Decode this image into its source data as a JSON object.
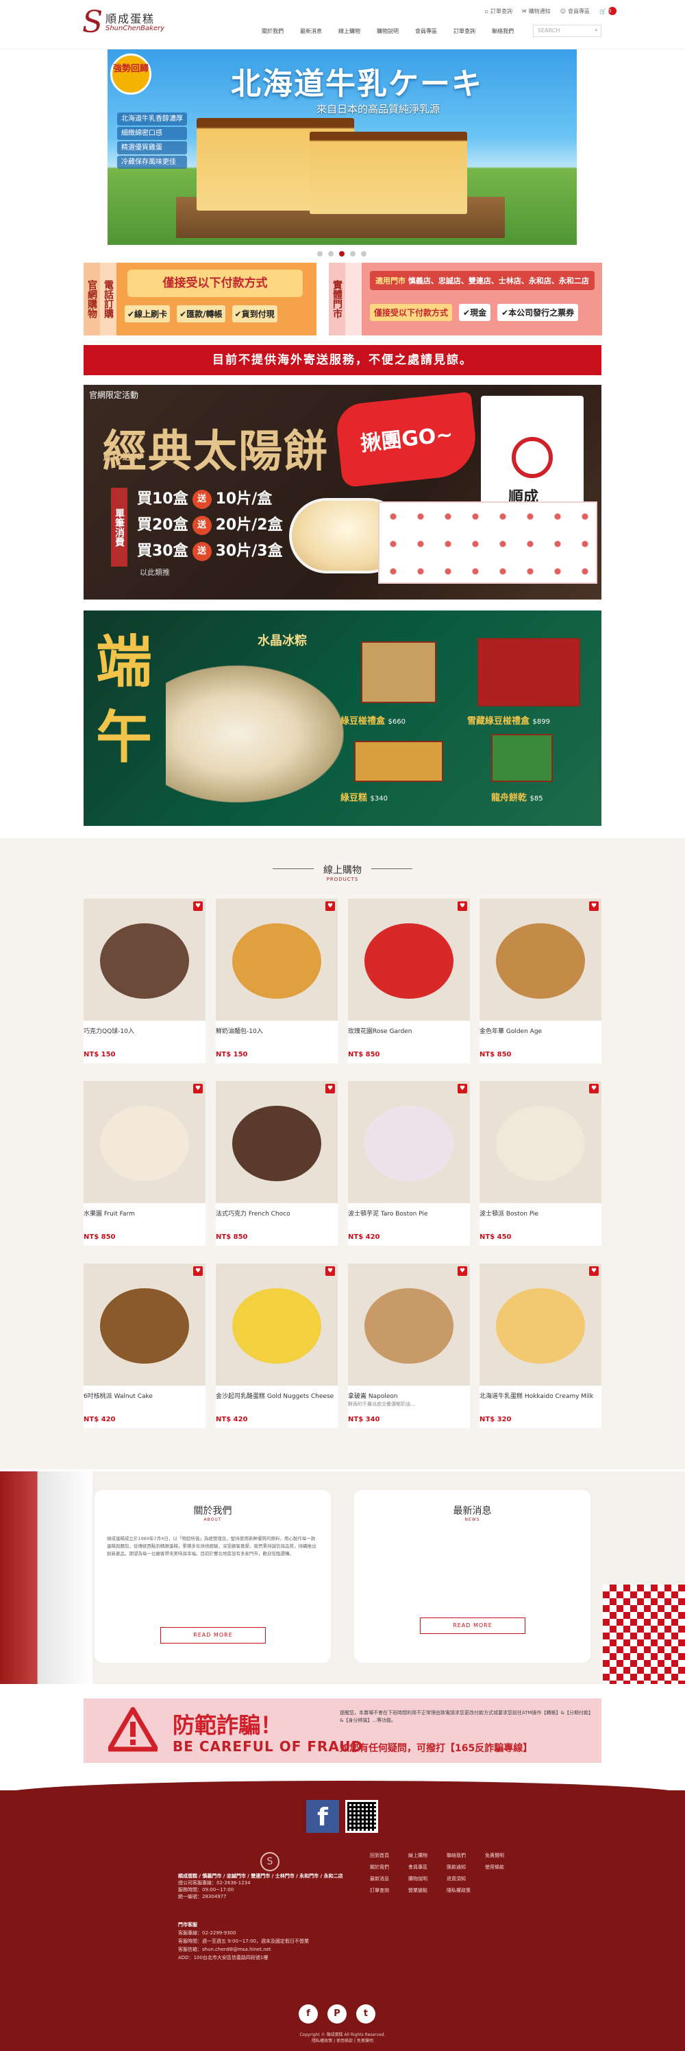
{
  "header": {
    "logo_cn": "順成蛋糕",
    "logo_en": "ShunChenBakery",
    "util": [
      "訂單查詢",
      "購物通知",
      "會員專區"
    ],
    "cart_count": "0",
    "nav": [
      "關於我們",
      "最新消息",
      "線上購物",
      "購物說明",
      "會員專區",
      "訂單查詢",
      "聯絡我們"
    ],
    "search_placeholder": "SEARCH"
  },
  "banner": {
    "badge": "強勢回歸",
    "title": "北海道牛乳ケーキ",
    "subtitle": "來自日本的高品質純淨乳源",
    "points": [
      "北海道牛乳香醇濃厚",
      "細緻綿密口感",
      "精選優質雞蛋",
      "冷藏保存風味更佳"
    ],
    "dots": [
      "1",
      "2",
      "3",
      "4",
      "5"
    ],
    "active_dot": 3
  },
  "order_info": {
    "left_tag": "官網購物",
    "left_tag2": "電話訂購",
    "left_pay": "僅接受以下付款方式",
    "left_methods": [
      "✔線上刷卡",
      "✔匯款/轉帳",
      "✔貨到付現"
    ],
    "right_tag": "實體門市",
    "right_stores_label": "適用門市",
    "right_stores": "慎義店、忠誠店、雙連店、士林店、永和店、永和二店",
    "right_pay": "僅接受以下付款方式",
    "right_methods": [
      "✔現金",
      "✔本公司發行之票券"
    ]
  },
  "notice": "目前不提供海外寄送服務，不便之處請見諒。",
  "promo1": {
    "tag": "官網限定活動",
    "title": "經典太陽餅",
    "buy_offer": "買10送10",
    "side": "單筆消費",
    "deals": [
      {
        "buy": "買10盒",
        "send": "送",
        "get": "10片/盒"
      },
      {
        "buy": "買20盒",
        "send": "送",
        "get": "20片/2盒"
      },
      {
        "buy": "買30盒",
        "send": "送",
        "get": "30片/3盒"
      }
    ],
    "note": "以此類推",
    "burst": "揪團GO~",
    "brand": "順成"
  },
  "promo2": {
    "title": "端午",
    "sub": "水晶冰粽",
    "items": [
      {
        "name": "綠豆椪禮盒",
        "price": "$660"
      },
      {
        "name": "雪藏綠豆椪禮盒",
        "price": "$899"
      },
      {
        "name": "綠豆糕",
        "price": "$340"
      },
      {
        "name": "龍舟餅乾",
        "price": "$85"
      }
    ]
  },
  "shop": {
    "title": "線上購物",
    "subtitle": "PRODUCTS",
    "products": [
      {
        "name": "巧克力QQ球-10入",
        "desc": "",
        "price": "NT$ 150",
        "color": "#6b4a3a"
      },
      {
        "name": "鮮奶油麵包-10入",
        "desc": "",
        "price": "NT$ 150",
        "color": "#e0a040"
      },
      {
        "name": "玫瑰花園Rose Garden",
        "desc": "",
        "price": "NT$ 850",
        "color": "#d82828"
      },
      {
        "name": "金色年華 Golden Age",
        "desc": "",
        "price": "NT$ 850",
        "color": "#c48a48"
      },
      {
        "name": "水果園 Fruit Farm",
        "desc": "",
        "price": "NT$ 850",
        "color": "#f4e8d8"
      },
      {
        "name": "法式巧克力 French Choco",
        "desc": "",
        "price": "NT$ 850",
        "color": "#5a3a2a"
      },
      {
        "name": "波士頓芋泥 Taro Boston Pie",
        "desc": "",
        "price": "NT$ 420",
        "color": "#ece4ea"
      },
      {
        "name": "波士頓派 Boston Pie",
        "desc": "",
        "price": "NT$ 450",
        "color": "#f0e8d8"
      },
      {
        "name": "6吋核桃派 Walnut Cake",
        "desc": "",
        "price": "NT$ 420",
        "color": "#8a5a2a"
      },
      {
        "name": "金沙起司乳酪蛋糕 Gold Nuggets Cheese",
        "desc": "",
        "price": "NT$ 420",
        "color": "#f2d040"
      },
      {
        "name": "拿破崙 Napoleon",
        "desc": "酥香的千層派皮交疊濃郁奶油...",
        "price": "NT$ 340",
        "color": "#c89a68"
      },
      {
        "name": "北海道牛乳蛋糕 Hokkaido Creamy Milk",
        "desc": "",
        "price": "NT$ 320",
        "color": "#f2c870"
      }
    ]
  },
  "about": {
    "title": "關於我們",
    "subtitle": "ABOUT",
    "body": "順成蛋糕成立於1969年7月4日，以「物超所值」為經營理念，堅持使用新鮮優質的原料，用心製作每一款蛋糕與麵包，從傳統西點到精緻蛋糕，累積多年烘焙經驗，深受顧客喜愛。我們秉持誠信與品質，持續推出創新產品，期望為每一位顧客帶來美味與幸福。目前於雙北地區設有多家門市，歡迎蒞臨選購。",
    "more": "READ MORE"
  },
  "news": {
    "title": "最新消息",
    "subtitle": "NEWS",
    "more": "READ MORE"
  },
  "fraud": {
    "title": "防範詐騙！",
    "title_en": "BE CAREFUL OF FRAUD",
    "text": "提醒您，本賣場不會在下班時間利用不正常理由致電請求您更改付款方式或要求您前往ATM操作【轉帳】&【分期付款】&【身分辨識】...等功能。",
    "hotline": "如您有任何疑問，可撥打【165反詐騙專線】"
  },
  "footer": {
    "fb": "f",
    "brand_lines": [
      "順成蛋糕 / 慎義門市 / 忠誠門市 / 雙連門市 / 士林門市 / 永和門市 / 永和二店",
      "總公司客服專線：02-2636-1234",
      "服務時間：09:00~17:00",
      "統一編號：28304977"
    ],
    "links": [
      "回到首頁",
      "線上購物",
      "聯絡我們",
      "免責聲明",
      "關於我們",
      "會員專區",
      "匯款通知",
      "使用條款",
      "最新消息",
      "購物說明",
      "退貨須知",
      "",
      "訂單查詢",
      "營業據點",
      "隱私權政策",
      ""
    ],
    "contact": [
      "門市客服",
      "客服專線：02-2299-9300",
      "客服時間：週一至週五 9:00~17:00，週末及國定假日不營業",
      "客服信箱：shun.chen88@msa.hinet.net",
      "ADD：100台北市大安區信義路四段號1樓"
    ],
    "social": [
      "f",
      "P",
      "t"
    ],
    "copy": [
      "Copyright © 順成蛋糕 All Rights Reserved.",
      "隱私權政策 | 使用條款 | 免責聲明"
    ]
  }
}
